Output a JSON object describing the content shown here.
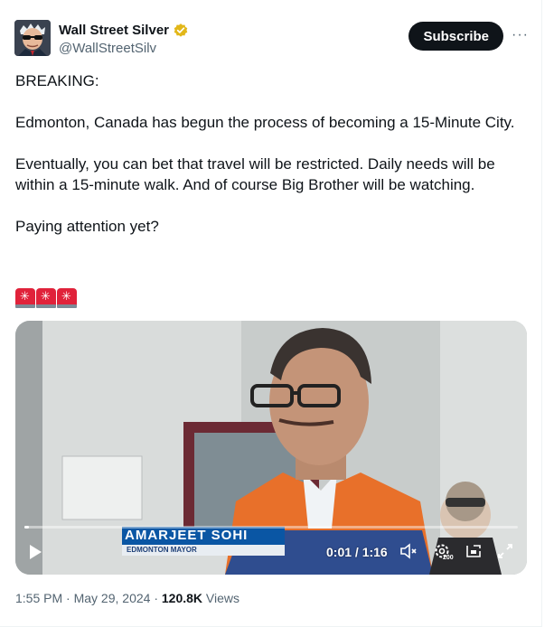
{
  "author": {
    "display_name": "Wall Street Silver",
    "handle": "@WallStreetSilv",
    "avatar_icon": "avatar-sunglasses-icon",
    "verified_color": "#e2b719"
  },
  "actions": {
    "subscribe_label": "Subscribe",
    "more_label": "···"
  },
  "post": {
    "paragraphs": [
      "BREAKING:",
      "Edmonton, Canada has begun the process of becoming a 15-Minute City.",
      "Eventually, you can bet that travel will be restricted. Daily needs will be within a 15-minute walk. And of course Big Brother will be watching.",
      "Paying attention yet?"
    ],
    "emoji_icon": "police-siren-icon",
    "emoji_count": 3
  },
  "video": {
    "chyron_name": "AMARJEET SOHI",
    "chyron_title": "EDMONTON MAYOR",
    "time_display": "0:01 / 1:16",
    "progress": 0.01,
    "icons": [
      "play-icon",
      "mute-icon",
      "settings-icon",
      "pip-icon",
      "fullscreen-icon"
    ],
    "settings_badge": "200"
  },
  "meta": {
    "time": "1:55 PM",
    "separator1": " · ",
    "date": "May 29, 2024",
    "separator2": " · ",
    "views_count": "120.8K",
    "views_label": " Views"
  }
}
